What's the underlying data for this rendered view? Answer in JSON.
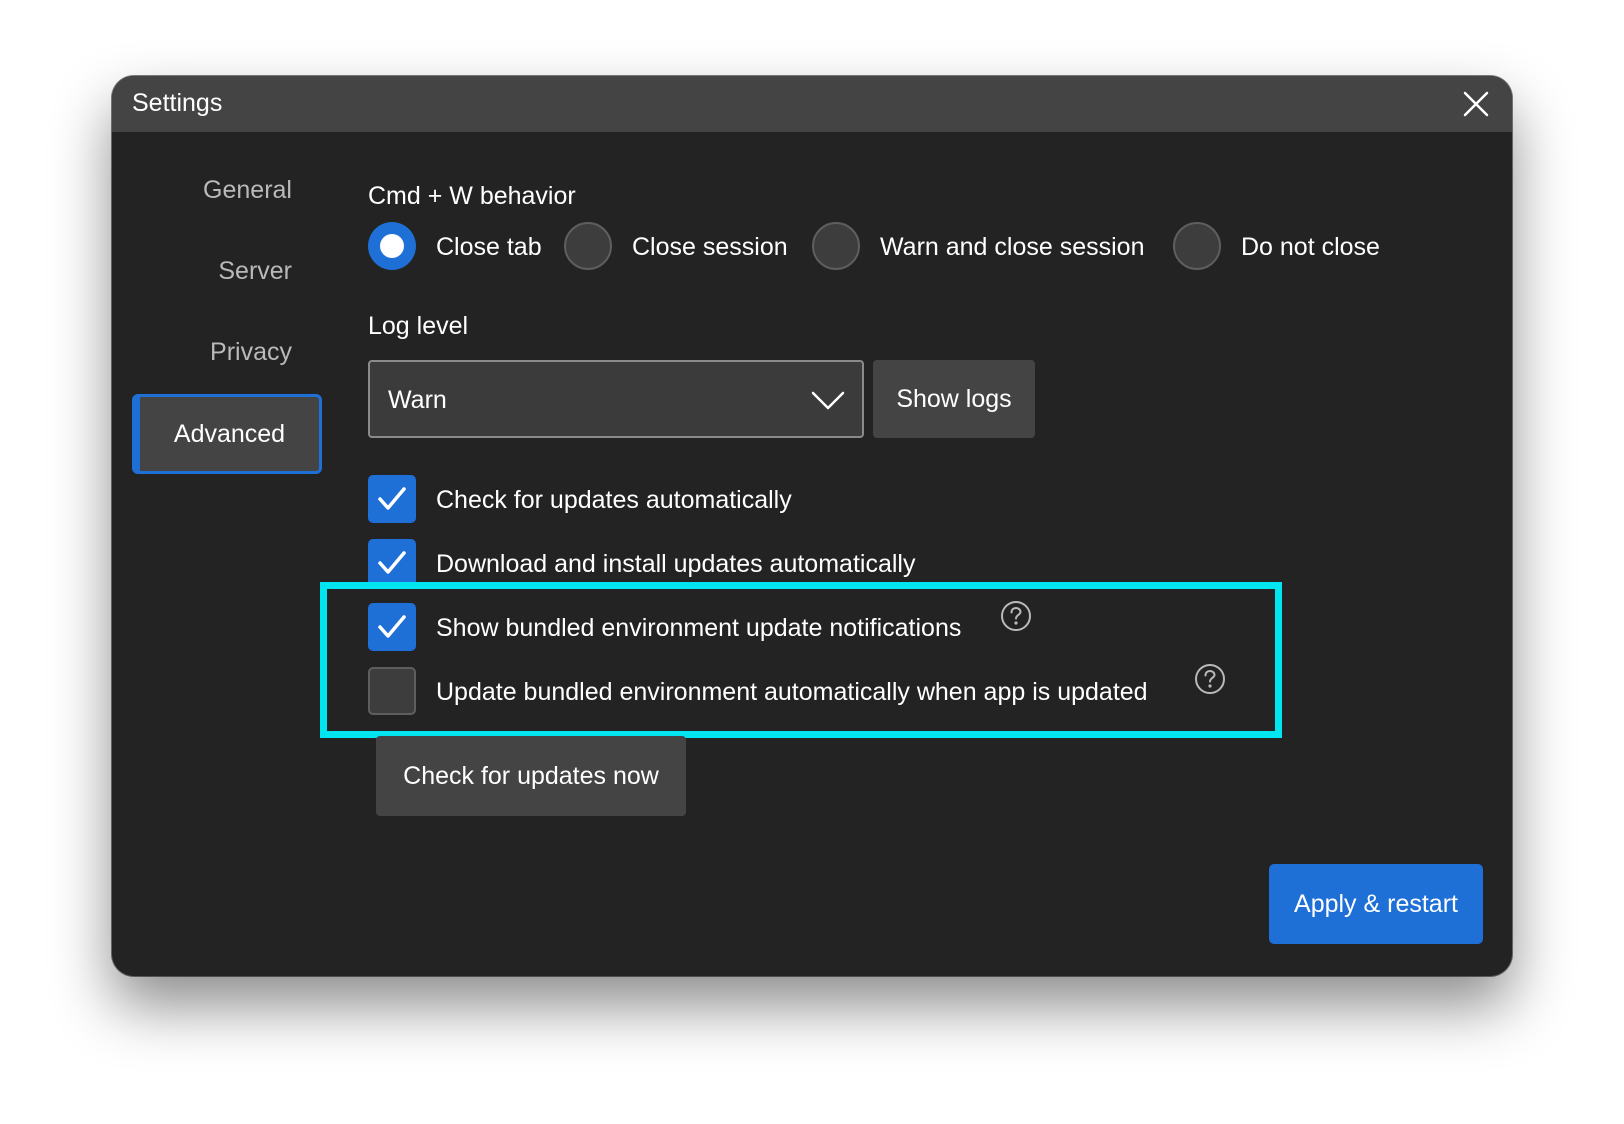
{
  "window": {
    "title": "Settings"
  },
  "sidebar": {
    "items": [
      {
        "label": "General",
        "active": false
      },
      {
        "label": "Server",
        "active": false
      },
      {
        "label": "Privacy",
        "active": false
      },
      {
        "label": "Advanced",
        "active": true
      }
    ]
  },
  "cmdw": {
    "label": "Cmd + W behavior",
    "options": [
      {
        "label": "Close tab",
        "selected": true
      },
      {
        "label": "Close session",
        "selected": false
      },
      {
        "label": "Warn and close session",
        "selected": false
      },
      {
        "label": "Do not close",
        "selected": false
      }
    ]
  },
  "log": {
    "label": "Log level",
    "value": "Warn",
    "show_logs_label": "Show logs"
  },
  "updates": {
    "checkboxes": [
      {
        "label": "Check for updates automatically",
        "checked": true
      },
      {
        "label": "Download and install updates automatically",
        "checked": true
      },
      {
        "label": "Show bundled environment update notifications",
        "checked": true
      },
      {
        "label": "Update bundled environment automatically when app is updated",
        "checked": false
      }
    ],
    "check_now_label": "Check for updates now"
  },
  "footer": {
    "apply_label": "Apply & restart"
  },
  "colors": {
    "accent": "#1e6fd6",
    "highlight": "#00e5f0",
    "background": "#232323",
    "titlebar": "#444444"
  }
}
